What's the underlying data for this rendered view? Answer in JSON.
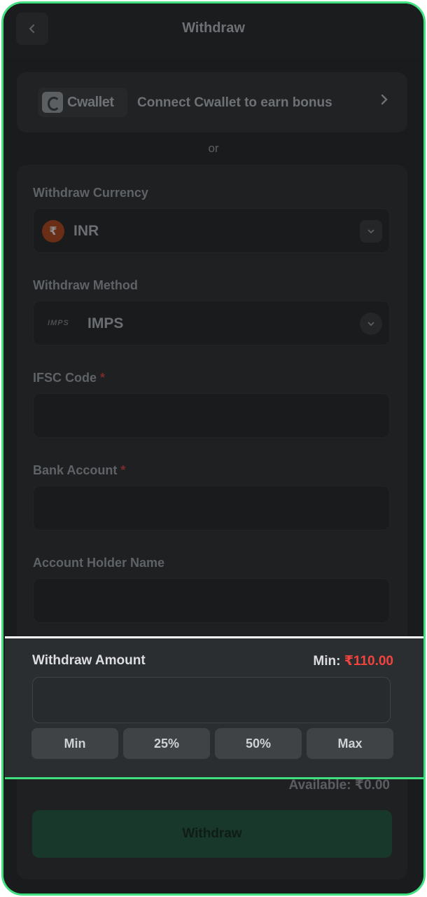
{
  "header": {
    "title": "Withdraw"
  },
  "cwallet": {
    "brand": "Cwallet",
    "text": "Connect Cwallet to earn bonus"
  },
  "separator": "or",
  "currency": {
    "label": "Withdraw Currency",
    "value": "INR",
    "symbol": "₹"
  },
  "method": {
    "label": "Withdraw Method",
    "logo_text": "IMPS",
    "value": "IMPS"
  },
  "ifsc": {
    "label": "IFSC Code",
    "required_mark": "*",
    "value": ""
  },
  "bank_account": {
    "label": "Bank Account",
    "required_mark": "*",
    "value": ""
  },
  "holder_name": {
    "label": "Account Holder Name",
    "value": ""
  },
  "amount": {
    "label": "Withdraw Amount",
    "min_label": "Min:",
    "min_value": "₹110.00",
    "value": "",
    "quick": [
      "Min",
      "25%",
      "50%",
      "Max"
    ]
  },
  "available": "Available: ₹0.00",
  "submit_label": "Withdraw",
  "colors": {
    "frame_border": "#3fe07f",
    "min_value": "#f0443f",
    "submit_bg": "#17382a"
  }
}
